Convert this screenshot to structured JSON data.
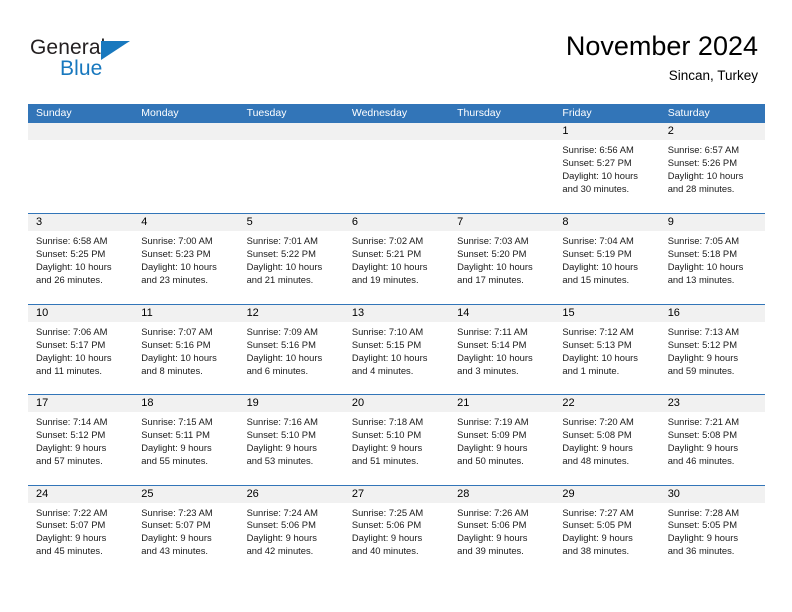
{
  "logo": {
    "word1": "General",
    "word2": "Blue",
    "triangle_color": "#1878be"
  },
  "header": {
    "title": "November 2024",
    "subtitle": "Sincan, Turkey",
    "accent_color": "#3275b8"
  },
  "weekdays": [
    "Sunday",
    "Monday",
    "Tuesday",
    "Wednesday",
    "Thursday",
    "Friday",
    "Saturday"
  ],
  "weeks": [
    [
      {
        "day": "",
        "lines": []
      },
      {
        "day": "",
        "lines": []
      },
      {
        "day": "",
        "lines": []
      },
      {
        "day": "",
        "lines": []
      },
      {
        "day": "",
        "lines": []
      },
      {
        "day": "1",
        "lines": [
          "Sunrise: 6:56 AM",
          "Sunset: 5:27 PM",
          "Daylight: 10 hours",
          "and 30 minutes."
        ]
      },
      {
        "day": "2",
        "lines": [
          "Sunrise: 6:57 AM",
          "Sunset: 5:26 PM",
          "Daylight: 10 hours",
          "and 28 minutes."
        ]
      }
    ],
    [
      {
        "day": "3",
        "lines": [
          "Sunrise: 6:58 AM",
          "Sunset: 5:25 PM",
          "Daylight: 10 hours",
          "and 26 minutes."
        ]
      },
      {
        "day": "4",
        "lines": [
          "Sunrise: 7:00 AM",
          "Sunset: 5:23 PM",
          "Daylight: 10 hours",
          "and 23 minutes."
        ]
      },
      {
        "day": "5",
        "lines": [
          "Sunrise: 7:01 AM",
          "Sunset: 5:22 PM",
          "Daylight: 10 hours",
          "and 21 minutes."
        ]
      },
      {
        "day": "6",
        "lines": [
          "Sunrise: 7:02 AM",
          "Sunset: 5:21 PM",
          "Daylight: 10 hours",
          "and 19 minutes."
        ]
      },
      {
        "day": "7",
        "lines": [
          "Sunrise: 7:03 AM",
          "Sunset: 5:20 PM",
          "Daylight: 10 hours",
          "and 17 minutes."
        ]
      },
      {
        "day": "8",
        "lines": [
          "Sunrise: 7:04 AM",
          "Sunset: 5:19 PM",
          "Daylight: 10 hours",
          "and 15 minutes."
        ]
      },
      {
        "day": "9",
        "lines": [
          "Sunrise: 7:05 AM",
          "Sunset: 5:18 PM",
          "Daylight: 10 hours",
          "and 13 minutes."
        ]
      }
    ],
    [
      {
        "day": "10",
        "lines": [
          "Sunrise: 7:06 AM",
          "Sunset: 5:17 PM",
          "Daylight: 10 hours",
          "and 11 minutes."
        ]
      },
      {
        "day": "11",
        "lines": [
          "Sunrise: 7:07 AM",
          "Sunset: 5:16 PM",
          "Daylight: 10 hours",
          "and 8 minutes."
        ]
      },
      {
        "day": "12",
        "lines": [
          "Sunrise: 7:09 AM",
          "Sunset: 5:16 PM",
          "Daylight: 10 hours",
          "and 6 minutes."
        ]
      },
      {
        "day": "13",
        "lines": [
          "Sunrise: 7:10 AM",
          "Sunset: 5:15 PM",
          "Daylight: 10 hours",
          "and 4 minutes."
        ]
      },
      {
        "day": "14",
        "lines": [
          "Sunrise: 7:11 AM",
          "Sunset: 5:14 PM",
          "Daylight: 10 hours",
          "and 3 minutes."
        ]
      },
      {
        "day": "15",
        "lines": [
          "Sunrise: 7:12 AM",
          "Sunset: 5:13 PM",
          "Daylight: 10 hours",
          "and 1 minute."
        ]
      },
      {
        "day": "16",
        "lines": [
          "Sunrise: 7:13 AM",
          "Sunset: 5:12 PM",
          "Daylight: 9 hours",
          "and 59 minutes."
        ]
      }
    ],
    [
      {
        "day": "17",
        "lines": [
          "Sunrise: 7:14 AM",
          "Sunset: 5:12 PM",
          "Daylight: 9 hours",
          "and 57 minutes."
        ]
      },
      {
        "day": "18",
        "lines": [
          "Sunrise: 7:15 AM",
          "Sunset: 5:11 PM",
          "Daylight: 9 hours",
          "and 55 minutes."
        ]
      },
      {
        "day": "19",
        "lines": [
          "Sunrise: 7:16 AM",
          "Sunset: 5:10 PM",
          "Daylight: 9 hours",
          "and 53 minutes."
        ]
      },
      {
        "day": "20",
        "lines": [
          "Sunrise: 7:18 AM",
          "Sunset: 5:10 PM",
          "Daylight: 9 hours",
          "and 51 minutes."
        ]
      },
      {
        "day": "21",
        "lines": [
          "Sunrise: 7:19 AM",
          "Sunset: 5:09 PM",
          "Daylight: 9 hours",
          "and 50 minutes."
        ]
      },
      {
        "day": "22",
        "lines": [
          "Sunrise: 7:20 AM",
          "Sunset: 5:08 PM",
          "Daylight: 9 hours",
          "and 48 minutes."
        ]
      },
      {
        "day": "23",
        "lines": [
          "Sunrise: 7:21 AM",
          "Sunset: 5:08 PM",
          "Daylight: 9 hours",
          "and 46 minutes."
        ]
      }
    ],
    [
      {
        "day": "24",
        "lines": [
          "Sunrise: 7:22 AM",
          "Sunset: 5:07 PM",
          "Daylight: 9 hours",
          "and 45 minutes."
        ]
      },
      {
        "day": "25",
        "lines": [
          "Sunrise: 7:23 AM",
          "Sunset: 5:07 PM",
          "Daylight: 9 hours",
          "and 43 minutes."
        ]
      },
      {
        "day": "26",
        "lines": [
          "Sunrise: 7:24 AM",
          "Sunset: 5:06 PM",
          "Daylight: 9 hours",
          "and 42 minutes."
        ]
      },
      {
        "day": "27",
        "lines": [
          "Sunrise: 7:25 AM",
          "Sunset: 5:06 PM",
          "Daylight: 9 hours",
          "and 40 minutes."
        ]
      },
      {
        "day": "28",
        "lines": [
          "Sunrise: 7:26 AM",
          "Sunset: 5:06 PM",
          "Daylight: 9 hours",
          "and 39 minutes."
        ]
      },
      {
        "day": "29",
        "lines": [
          "Sunrise: 7:27 AM",
          "Sunset: 5:05 PM",
          "Daylight: 9 hours",
          "and 38 minutes."
        ]
      },
      {
        "day": "30",
        "lines": [
          "Sunrise: 7:28 AM",
          "Sunset: 5:05 PM",
          "Daylight: 9 hours",
          "and 36 minutes."
        ]
      }
    ]
  ]
}
